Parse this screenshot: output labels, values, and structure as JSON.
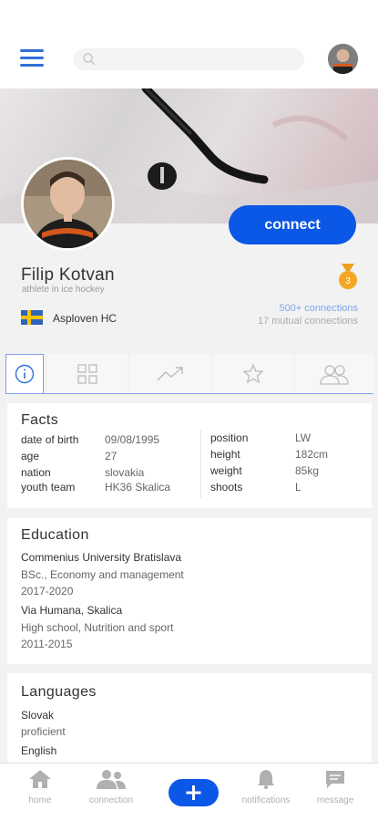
{
  "header": {
    "search_placeholder": "",
    "menu_icon": "hamburger-menu-icon",
    "avatar_icon": "user-avatar"
  },
  "profile": {
    "name": "Filip Kotvan",
    "subtitle": "athlete in ice hockey",
    "connect_label": "connect",
    "medal_number": "3",
    "team": "Asploven HC",
    "connections": "500+ connections",
    "mutual": "17 mutual connections",
    "accent_color": "#0b57e6"
  },
  "tabs": [
    {
      "name": "info",
      "icon": "info-icon",
      "active": true
    },
    {
      "name": "grid",
      "icon": "grid-icon",
      "active": false
    },
    {
      "name": "stats",
      "icon": "trending-up-icon",
      "active": false
    },
    {
      "name": "favorites",
      "icon": "star-icon",
      "active": false
    },
    {
      "name": "people",
      "icon": "people-icon",
      "active": false
    }
  ],
  "facts": {
    "title": "Facts",
    "left": [
      {
        "label": "date of birth",
        "value": "09/08/1995"
      },
      {
        "label": "age",
        "value": "27"
      },
      {
        "label": "nation",
        "value": "slovakia"
      },
      {
        "label": "youth team",
        "value": "HK36 Skalica"
      }
    ],
    "right": [
      {
        "label": "position",
        "value": "LW"
      },
      {
        "label": "height",
        "value": "182cm"
      },
      {
        "label": "weight",
        "value": "85kg"
      },
      {
        "label": "shoots",
        "value": "L"
      }
    ]
  },
  "education": {
    "title": "Education",
    "entries": [
      {
        "school": "Commenius University Bratislava",
        "degree": "BSc., Economy and management",
        "years": "2017-2020"
      },
      {
        "school": "Via Humana, Skalica",
        "degree": "High school, Nutrition and sport",
        "years": "2011-2015"
      }
    ]
  },
  "languages": {
    "title": "Languages",
    "items": [
      {
        "language": "Slovak",
        "level": "proficient"
      },
      {
        "language": "English",
        "level": ""
      }
    ]
  },
  "bottom_nav": {
    "home": "home",
    "connection": "connection",
    "notifications": "notifications",
    "message": "message"
  }
}
